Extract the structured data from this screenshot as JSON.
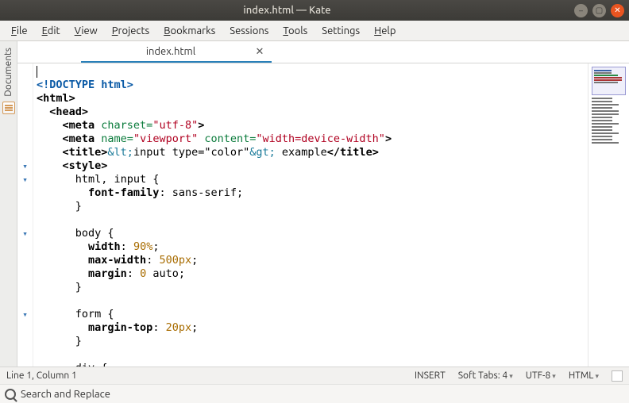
{
  "titlebar": {
    "title": "index.html — Kate"
  },
  "menu": {
    "items": [
      {
        "accel": "F",
        "rest": "ile"
      },
      {
        "accel": "E",
        "rest": "dit"
      },
      {
        "accel": "V",
        "rest": "iew"
      },
      {
        "accel": "P",
        "rest": "rojects"
      },
      {
        "accel": "B",
        "rest": "ookmarks"
      },
      {
        "accel": "",
        "rest": "Sessions"
      },
      {
        "accel": "T",
        "rest": "ools"
      },
      {
        "accel": "",
        "rest": "Settings"
      },
      {
        "accel": "H",
        "rest": "elp"
      }
    ]
  },
  "leftbar": {
    "label": "Documents"
  },
  "tabs": [
    {
      "label": "index.html"
    }
  ],
  "code": {
    "line1": "",
    "l2a": "<!DOCTYPE",
    "l2b": " html",
    "l2c": ">",
    "l3a": "<html>",
    "l4a": "  ",
    "l4b": "<head>",
    "l5a": "    ",
    "l5b": "<meta",
    "l5c": " charset=",
    "l5d": "\"utf-8\"",
    "l5e": ">",
    "l6a": "    ",
    "l6b": "<meta",
    "l6c": " name=",
    "l6d": "\"viewport\"",
    "l6e": " content=",
    "l6f": "\"width=device-width\"",
    "l6g": ">",
    "l7a": "    ",
    "l7b": "<title>",
    "l7c": "&lt;",
    "l7d": "input type=\"color\"",
    "l7e": "&gt;",
    "l7f": " example",
    "l7g": "</title>",
    "l8a": "    ",
    "l8b": "<style>",
    "l9": "      html, input {",
    "l10a": "        ",
    "l10b": "font-family",
    "l10c": ": sans-serif;",
    "l11": "      }",
    "l12": "",
    "l13": "      body {",
    "l14a": "        ",
    "l14b": "width",
    "l14c": ": ",
    "l14d": "90%",
    "l14e": ";",
    "l15a": "        ",
    "l15b": "max-width",
    "l15c": ": ",
    "l15d": "500px",
    "l15e": ";",
    "l16a": "        ",
    "l16b": "margin",
    "l16c": ": ",
    "l16d": "0",
    "l16e": " auto;",
    "l17": "      }",
    "l18": "",
    "l19": "      form {",
    "l20a": "        ",
    "l20b": "margin-top",
    "l20c": ": ",
    "l20d": "20px",
    "l20e": ";",
    "l21": "      }",
    "l22": "",
    "l23": "      div {"
  },
  "statusbar": {
    "position": "Line 1, Column 1",
    "mode": "INSERT",
    "tabs": "Soft Tabs: 4",
    "encoding": "UTF-8",
    "syntax": "HTML"
  },
  "search": {
    "label": "Search and Replace"
  }
}
